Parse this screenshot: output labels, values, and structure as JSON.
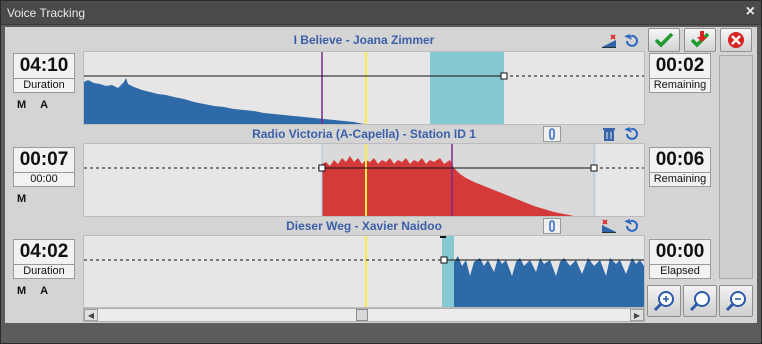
{
  "window": {
    "title": "Voice Tracking"
  },
  "tracks": [
    {
      "title": "I Believe - Joana Zimmer",
      "time": "04:10",
      "time_label": "Duration",
      "right_time": "00:02",
      "right_label": "Remaining",
      "m": "M",
      "a": "A",
      "wave_color": "#2f6aa8"
    },
    {
      "title": "Radio Victoria (A-Capella) - Station ID 1",
      "time": "00:07",
      "time_label": "00:00",
      "right_time": "00:06",
      "right_label": "Remaining",
      "m": "M",
      "wave_color": "#d43a3a"
    },
    {
      "title": "Dieser Weg - Xavier Naidoo",
      "time": "04:02",
      "time_label": "Duration",
      "right_time": "00:00",
      "right_label": "Elapsed",
      "m": "M",
      "a": "A",
      "wave_color": "#2f6aa8"
    }
  ],
  "colors": {
    "accent_teal": "#86c9d2",
    "playhead": "#f4ee4a",
    "marker": "#7a2a8a",
    "title_blue": "#3b5fa8"
  },
  "icons": [
    "accept-icon",
    "download-icon",
    "cancel-icon",
    "zoom-in-icon",
    "zoom-icon",
    "zoom-out-icon",
    "link-icon",
    "trash-icon",
    "undo-icon",
    "fade-icon"
  ]
}
